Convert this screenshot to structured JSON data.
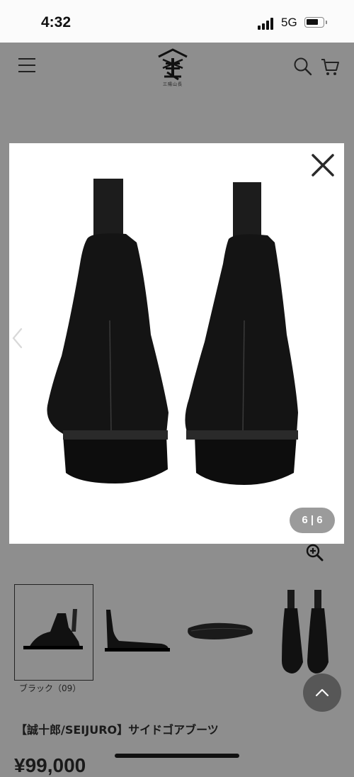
{
  "status_bar": {
    "time": "4:32",
    "network": "5G"
  },
  "header": {
    "logo_text": "三陽山長"
  },
  "lightbox": {
    "counter": "6 | 6"
  },
  "thumbnails": {
    "selected_caption": "ブラック（09）"
  },
  "product": {
    "title": "【誠十郎/SEIJURO】サイドゴアブーツ",
    "price": "¥99,000"
  },
  "icons": {
    "menu": "hamburger-icon",
    "search": "search-icon",
    "cart": "cart-icon",
    "close": "close-icon",
    "prev": "chevron-left-icon",
    "zoom": "zoom-in-icon",
    "scroll_top": "chevron-up-icon"
  }
}
